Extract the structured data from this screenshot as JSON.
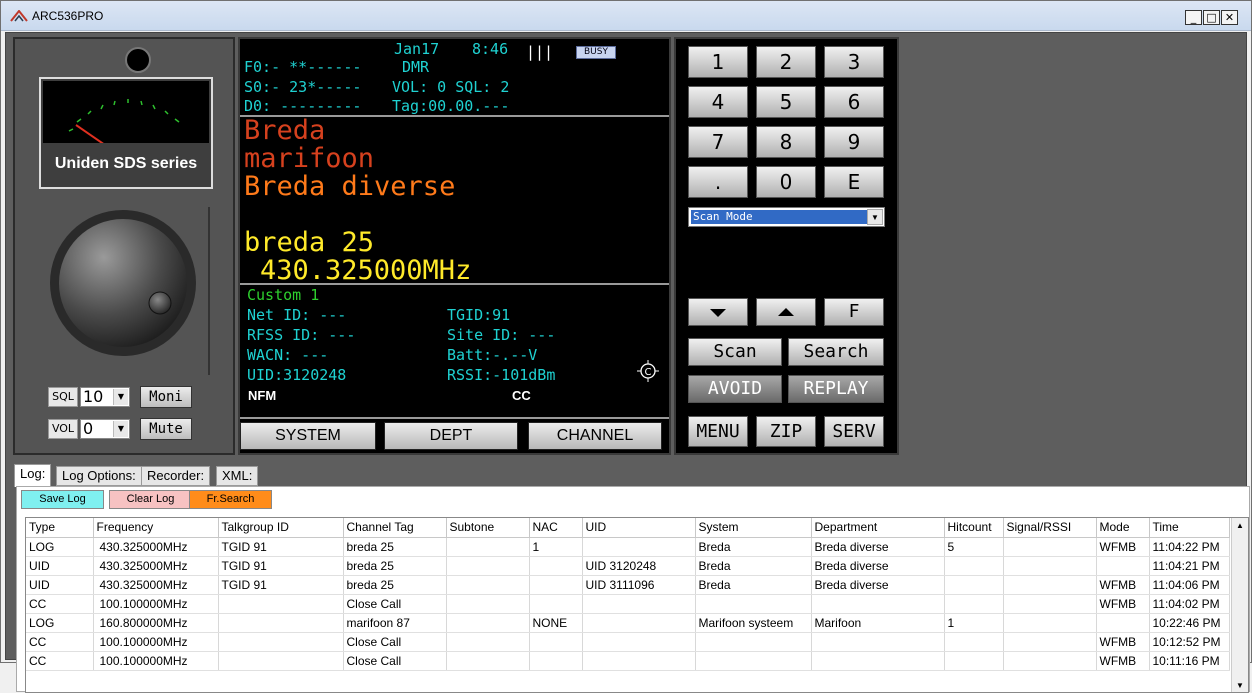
{
  "window": {
    "title": "ARC536PRO",
    "min": "_",
    "max": "□",
    "close": "✕"
  },
  "radio": {
    "brand": "Uniden SDS series",
    "sql_label": "SQL",
    "sql_value": "10",
    "vol_label": "VOL",
    "vol_value": "0",
    "moni": "Moni",
    "mute": "Mute"
  },
  "display": {
    "date": "Jan17",
    "time": "8:46",
    "signal_bars": "|||",
    "busy": "BUSY",
    "f0": "F0:- **------",
    "mode": "DMR",
    "s0": "S0:- 23*-----",
    "vol_sql": "VOL: 0 SQL: 2",
    "d0": "D0: ---------",
    "tag": "Tag:00.00.---",
    "system": "Breda",
    "department": "marifoon",
    "channel_group": "Breda diverse",
    "channel": "breda 25",
    "frequency": "430.325000MHz",
    "custom": "Custom 1",
    "net_id": "Net ID: ---",
    "tgid": "TGID:91",
    "rfss_id": "RFSS ID: ---",
    "site_id": "Site ID: ---",
    "wacn": "WACN: ---",
    "batt": "Batt:-.--V",
    "uid": "UID:3120248",
    "rssi": "RSSI:-101dBm",
    "modulation": "NFM",
    "cc": "CC",
    "btn_system": "SYSTEM",
    "btn_dept": "DEPT",
    "btn_channel": "CHANNEL"
  },
  "keypad": {
    "keys": [
      "1",
      "2",
      "3",
      "4",
      "5",
      "6",
      "7",
      "8",
      "9",
      ".",
      "0",
      "E"
    ],
    "scan_mode": "Scan Mode",
    "f": "F",
    "scan": "Scan",
    "search": "Search",
    "avoid": "AVOID",
    "replay": "REPLAY",
    "menu": "MENU",
    "zip": "ZIP",
    "serv": "SERV"
  },
  "tabs": [
    "Log:",
    "Log Options:",
    "Recorder:",
    "XML:"
  ],
  "log": {
    "save": "Save Log",
    "clear": "Clear Log",
    "fr_search": "Fr.Search",
    "colors": {
      "save": "#7ff0f0",
      "clear": "#f7c2c2",
      "fr_search": "#ff8c1a"
    },
    "columns": [
      "Type",
      "Frequency",
      "Talkgroup ID",
      "Channel Tag",
      "Subtone",
      "NAC",
      "UID",
      "System",
      "Department",
      "Hitcount",
      "Signal/RSSI",
      "Mode",
      "Time"
    ],
    "rows": [
      [
        "LOG",
        "430.325000MHz",
        "TGID 91",
        "breda 25",
        "",
        "1",
        "",
        "Breda",
        "Breda diverse",
        "5",
        "",
        "WFMB",
        "11:04:22 PM"
      ],
      [
        "UID",
        "430.325000MHz",
        "TGID 91",
        "breda 25",
        "",
        "",
        "UID 3120248",
        "Breda",
        "Breda diverse",
        "",
        "",
        "",
        "11:04:21 PM"
      ],
      [
        "UID",
        "430.325000MHz",
        "TGID 91",
        "breda 25",
        "",
        "",
        "UID 3111096",
        "Breda",
        "Breda diverse",
        "",
        "",
        "WFMB",
        "11:04:06 PM"
      ],
      [
        "CC",
        "100.100000MHz",
        "",
        "Close Call",
        "",
        "",
        "",
        "",
        "",
        "",
        "",
        "WFMB",
        "11:04:02 PM"
      ],
      [
        "LOG",
        "160.800000MHz",
        "",
        "marifoon 87",
        "",
        "NONE",
        "",
        "Marifoon systeem",
        "Marifoon",
        "1",
        "",
        "",
        "10:22:46 PM"
      ],
      [
        "CC",
        "100.100000MHz",
        "",
        "Close Call",
        "",
        "",
        "",
        "",
        "",
        "",
        "",
        "WFMB",
        "10:12:52 PM"
      ],
      [
        "CC",
        "100.100000MHz",
        "",
        "Close Call",
        "",
        "",
        "",
        "",
        "",
        "",
        "",
        "WFMB",
        "10:11:16 PM"
      ]
    ]
  }
}
